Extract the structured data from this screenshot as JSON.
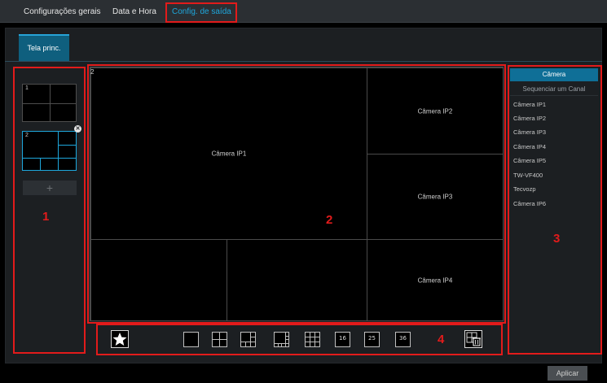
{
  "tabs": {
    "general": "Configurações gerais",
    "datetime": "Data e Hora",
    "output": "Config. de saída"
  },
  "screen_tab": "Tela princ.",
  "layouts": {
    "layout1_num": "1",
    "layout2_num": "2",
    "add": "+"
  },
  "grid": {
    "number": "2",
    "cam1": "Câmera IP1",
    "cam2": "Câmera IP2",
    "cam3": "Câmera IP3",
    "cam4": "Câmera IP4"
  },
  "camera_panel": {
    "header": "Câmera",
    "sequence": "Sequenciar um Canal",
    "items": [
      "Câmera IP1",
      "Câmera IP2",
      "Câmera IP3",
      "Câmera IP4",
      "Câmera IP5",
      "TW-VF400",
      "Tecvozp",
      "Câmera IP6"
    ]
  },
  "toolbar": {
    "btn16": "16",
    "btn25": "25",
    "btn36": "36"
  },
  "annotations": {
    "a1": "1",
    "a2": "2",
    "a3": "3",
    "a4": "4"
  },
  "apply": "Aplicar",
  "colors": {
    "accent": "#1ea7dc",
    "annotation": "#e21b1b",
    "header_blue": "#0f6f97"
  }
}
